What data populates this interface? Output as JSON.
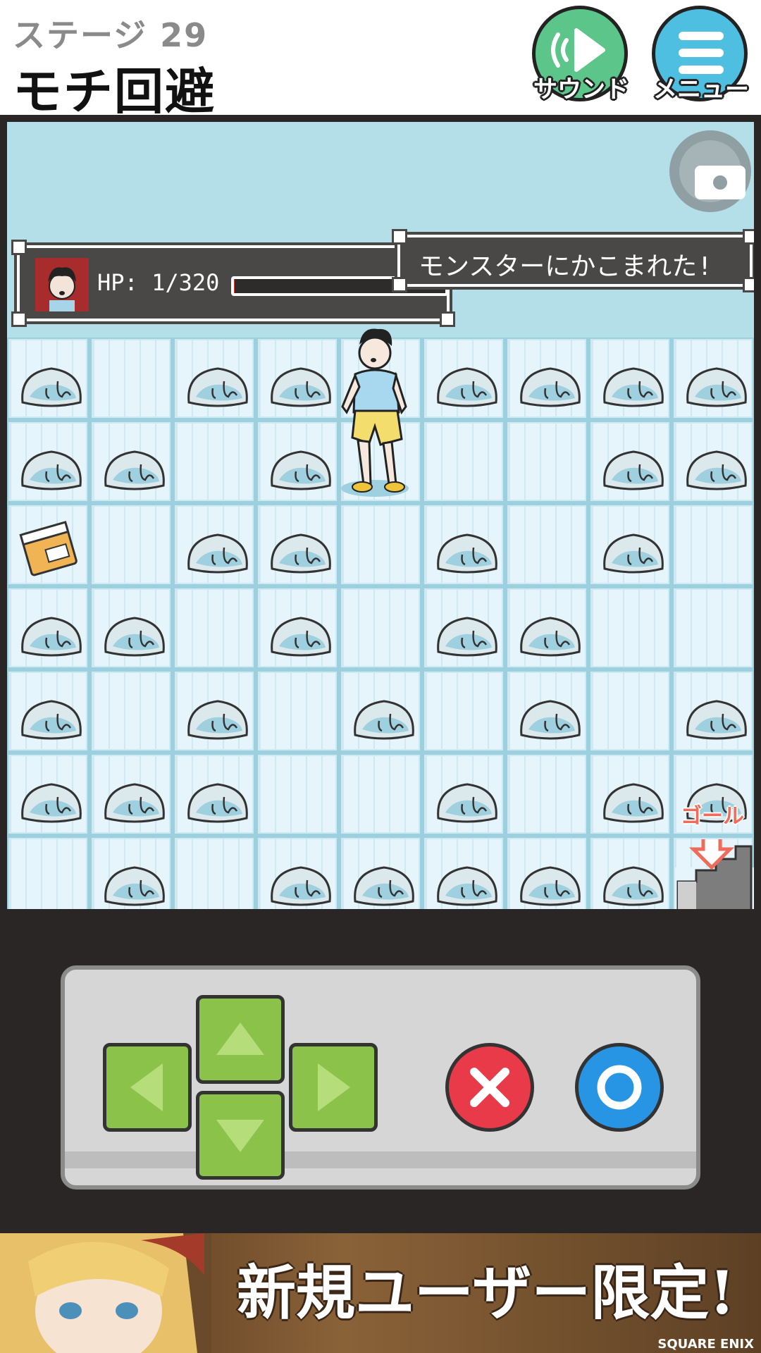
{
  "header": {
    "stage_label": "ステージ 29",
    "stage_title": "モチ回避",
    "sound_label": "サウンド",
    "menu_label": "メニュー"
  },
  "status": {
    "hp_text": "HP: 1/320",
    "hp_current": 1,
    "hp_max": 320,
    "message": "モンスターにかこまれた!"
  },
  "board": {
    "cols": 9,
    "rows": 7,
    "player_cell": [
      4,
      0
    ],
    "item_cell": [
      0,
      2
    ],
    "goal_cell": [
      8,
      6
    ],
    "goal_label": "ゴール",
    "slimes": [
      [
        0,
        0
      ],
      [
        2,
        0
      ],
      [
        3,
        0
      ],
      [
        5,
        0
      ],
      [
        6,
        0
      ],
      [
        7,
        0
      ],
      [
        8,
        0
      ],
      [
        0,
        1
      ],
      [
        1,
        1
      ],
      [
        3,
        1
      ],
      [
        7,
        1
      ],
      [
        8,
        1
      ],
      [
        2,
        2
      ],
      [
        3,
        2
      ],
      [
        5,
        2
      ],
      [
        7,
        2
      ],
      [
        0,
        3
      ],
      [
        1,
        3
      ],
      [
        3,
        3
      ],
      [
        5,
        3
      ],
      [
        6,
        3
      ],
      [
        0,
        4
      ],
      [
        2,
        4
      ],
      [
        4,
        4
      ],
      [
        6,
        4
      ],
      [
        8,
        4
      ],
      [
        0,
        5
      ],
      [
        1,
        5
      ],
      [
        2,
        5
      ],
      [
        5,
        5
      ],
      [
        7,
        5
      ],
      [
        8,
        5
      ],
      [
        1,
        6
      ],
      [
        3,
        6
      ],
      [
        4,
        6
      ],
      [
        5,
        6
      ],
      [
        6,
        6
      ],
      [
        7,
        6
      ]
    ]
  },
  "ad": {
    "headline": "新規ユーザー限定!",
    "brand": "SQUARE ENIX"
  },
  "colors": {
    "sound": "#5cc58a",
    "menu": "#4ebfe0",
    "dpad": "#8bc34a",
    "x_button": "#e83a48",
    "o_button": "#2795e4"
  }
}
